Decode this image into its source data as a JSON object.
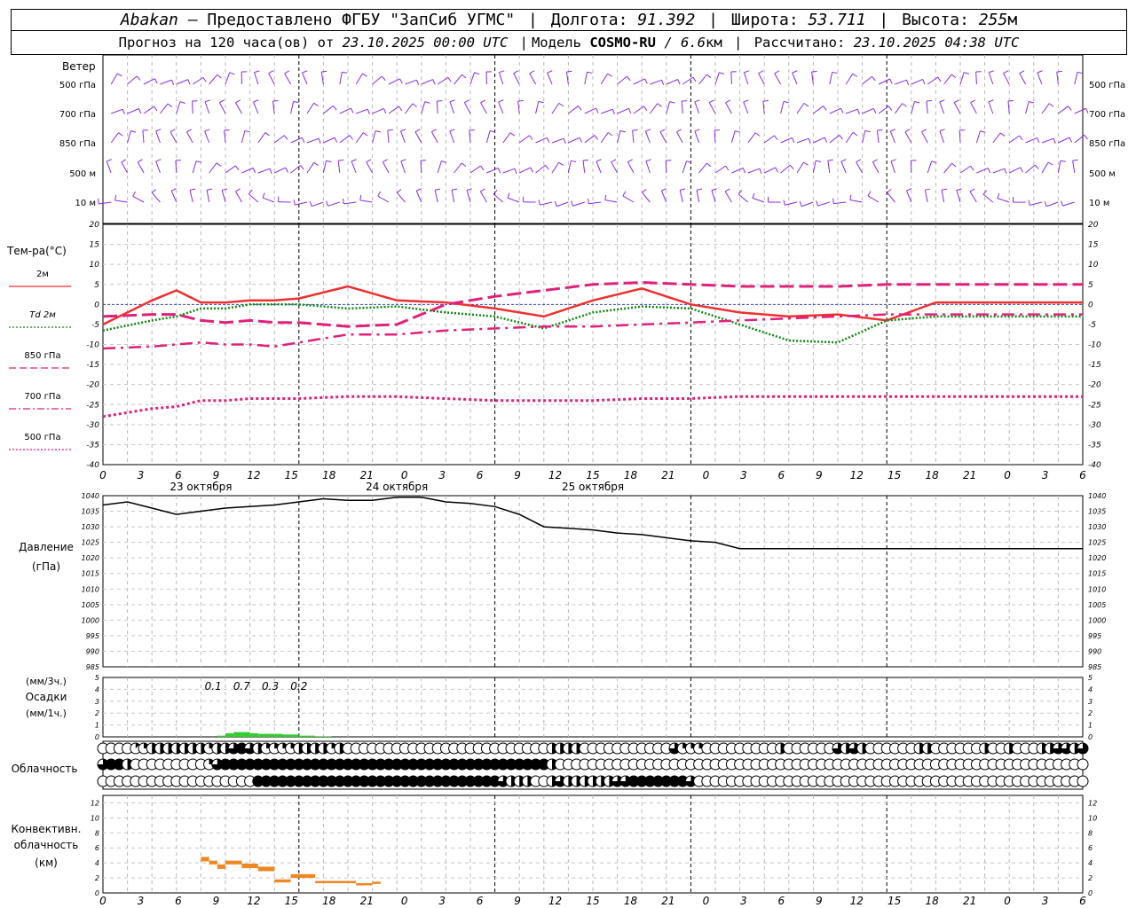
{
  "header": {
    "station": "Abakan",
    "dash": "—",
    "provider": "Предоставлено ФГБУ \"ЗапСиб УГМС\"",
    "lon_label": "Долгота:",
    "lon": "91.392",
    "lat_label": "Широта:",
    "lat": "53.711",
    "alt_label": "Высота:",
    "alt": "255",
    "alt_unit": "м",
    "forecast_label": "Прогноз на 120 часа(ов) от",
    "forecast_start": "23.10.2025 00:00 UTC",
    "model_label": "Модель",
    "model": "COSMO-RU",
    "model_res": "/ 6.6",
    "model_res_unit": "км",
    "computed_label": "Рассчитано:",
    "computed": "23.10.2025 04:38 UTC"
  },
  "wind_panel": {
    "title": "Ветер",
    "levels": [
      "500 гПа",
      "700 гПа",
      "850 гПа",
      "500 м",
      "10 м"
    ]
  },
  "temp_panel": {
    "title": "Тем-ра(°C)",
    "legend": [
      {
        "label": "2м",
        "color": "#ee3030",
        "style": "solid"
      },
      {
        "label": "Td  2м",
        "color": "#118811",
        "style": "dotted"
      },
      {
        "label": "850 гПа",
        "color": "#e0207a",
        "style": "dashed"
      },
      {
        "label": "700 гПа",
        "color": "#e0207a",
        "style": "dashdot"
      },
      {
        "label": "500 гПа",
        "color": "#e0207a",
        "style": "dotted"
      }
    ],
    "yticks": [
      20,
      15,
      10,
      5,
      0,
      -5,
      -10,
      -15,
      -20,
      -25,
      -30,
      -35,
      -40
    ]
  },
  "time_axis": {
    "hours": [
      "0",
      "3",
      "6",
      "9",
      "12",
      "15",
      "18",
      "21",
      "0",
      "3",
      "6",
      "9",
      "12",
      "15",
      "18",
      "21",
      "0",
      "3",
      "6",
      "9",
      "12",
      "15",
      "18",
      "21",
      "0",
      "3",
      "6"
    ],
    "dates": [
      "23 октября",
      "24 октября",
      "25 октября"
    ]
  },
  "pressure_panel": {
    "title": "Давление",
    "unit": "(гПа)",
    "yticks": [
      1040,
      1035,
      1030,
      1025,
      1020,
      1015,
      1010,
      1005,
      1000,
      995,
      990,
      985
    ]
  },
  "precip_panel": {
    "label_1": "(мм/3ч.)",
    "label_2": "Осадки",
    "label_3": "(мм/1ч.)",
    "yticks": [
      5,
      4,
      3,
      2,
      1,
      0
    ],
    "totals": [
      "0.1",
      "0.7",
      "0.3",
      "0.2"
    ]
  },
  "cloud_panel": {
    "title": "Облачность"
  },
  "conv_panel": {
    "title_1": "Конвективн.",
    "title_2": "облачность",
    "title_3": "(км)",
    "yticks": [
      12,
      10,
      8,
      6,
      4,
      2,
      0
    ]
  },
  "chart_data": [
    {
      "type": "line",
      "title": "Тем-ра(°C)",
      "x_unit": "hours from 23.10.2025 00:00 UTC",
      "ylim": [
        -40,
        20
      ],
      "grid": true,
      "x": [
        0,
        6,
        9,
        12,
        15,
        18,
        21,
        24,
        30,
        36,
        42,
        48,
        54,
        60,
        66,
        72,
        78,
        84,
        90,
        96,
        102,
        108,
        114,
        120
      ],
      "series": [
        {
          "name": "2м",
          "values": [
            -5,
            1,
            3.5,
            0.5,
            0.5,
            1,
            1,
            1.5,
            4.5,
            1,
            0.5,
            -1,
            -3,
            1,
            4,
            0,
            -2,
            -3,
            -2.5,
            -4,
            0.5,
            0.5,
            0.5,
            0.5
          ]
        },
        {
          "name": "Td  2м",
          "values": [
            -6.5,
            -4,
            -3,
            -1,
            -1,
            0,
            0,
            0,
            -1,
            -0.5,
            -2,
            -3,
            -6,
            -2,
            -0.5,
            -1,
            -5,
            -9,
            -9.5,
            -4,
            -3,
            -3,
            -3,
            -3
          ]
        },
        {
          "name": "850 гПа",
          "values": [
            -3,
            -2.5,
            -2.5,
            -4,
            -4.5,
            -4,
            -4.5,
            -4.5,
            -5.5,
            -5,
            0,
            2,
            3.5,
            5,
            5.5,
            5,
            4.5,
            4.5,
            4.5,
            5,
            5,
            5,
            5,
            5
          ]
        },
        {
          "name": "700 гПа",
          "values": [
            -11,
            -10.5,
            -10,
            -9.5,
            -10,
            -10,
            -10.5,
            -9.5,
            -7.5,
            -7.5,
            -6.5,
            -6,
            -5.5,
            -5.5,
            -5,
            -4.5,
            -4,
            -3.5,
            -3,
            -2.5,
            -2.5,
            -2.5,
            -2.5,
            -2.5
          ]
        },
        {
          "name": "500 гПа",
          "values": [
            -28,
            -26,
            -25.5,
            -24,
            -24,
            -23.5,
            -23.5,
            -23.5,
            -23,
            -23,
            -23.5,
            -24,
            -24,
            -24,
            -23.5,
            -23.5,
            -23,
            -23,
            -23,
            -23,
            -23,
            -23,
            -23,
            -23
          ]
        }
      ]
    },
    {
      "type": "line",
      "title": "Давление",
      "ylabel": "(гПа)",
      "x_unit": "hours from 23.10.2025 00:00 UTC",
      "ylim": [
        985,
        1040
      ],
      "grid": true,
      "x": [
        0,
        3,
        6,
        9,
        12,
        15,
        18,
        21,
        24,
        27,
        30,
        33,
        36,
        39,
        42,
        45,
        48,
        51,
        54,
        57,
        60,
        63,
        66,
        69,
        72,
        75,
        78,
        81,
        84,
        87,
        90,
        93,
        96,
        99,
        102,
        105,
        108,
        111,
        114,
        117,
        120
      ],
      "series": [
        {
          "name": "Давление",
          "values": [
            1037,
            1038,
            1036,
            1034,
            1035,
            1036,
            1036.5,
            1037,
            1038,
            1039,
            1038.5,
            1038.5,
            1039.5,
            1039.5,
            1038,
            1037.5,
            1036.5,
            1034,
            1030,
            1029.5,
            1029,
            1028,
            1027.5,
            1026.5,
            1025.5,
            1025,
            1023,
            1023,
            1023,
            1023,
            1023,
            1023,
            1023,
            1023,
            1023,
            1023,
            1023,
            1023,
            1023,
            1023,
            1023
          ]
        }
      ]
    },
    {
      "type": "bar",
      "title": "Осадки",
      "ylabel": "(мм/1ч.)",
      "ylim": [
        0,
        5
      ],
      "x": [
        14,
        15,
        16,
        17,
        18,
        19,
        20,
        21,
        22,
        23,
        24,
        25,
        26,
        27
      ],
      "values": [
        0.1,
        0.3,
        0.4,
        0.4,
        0.3,
        0.25,
        0.25,
        0.25,
        0.2,
        0.2,
        0.1,
        0.1,
        0.05,
        0.05
      ]
    },
    {
      "type": "bar",
      "title": "Конвективн. облачность",
      "ylabel": "(км)",
      "ylim": [
        0,
        13
      ],
      "series": [
        {
          "x0": 12,
          "x1": 13,
          "base": 4.2,
          "top": 4.8
        },
        {
          "x0": 13,
          "x1": 14,
          "base": 3.8,
          "top": 4.3
        },
        {
          "x0": 14,
          "x1": 15,
          "base": 3.2,
          "top": 3.8
        },
        {
          "x0": 15,
          "x1": 17,
          "base": 3.8,
          "top": 4.3
        },
        {
          "x0": 17,
          "x1": 19,
          "base": 3.3,
          "top": 3.9
        },
        {
          "x0": 19,
          "x1": 21,
          "base": 2.9,
          "top": 3.5
        },
        {
          "x0": 21,
          "x1": 23,
          "base": 1.4,
          "top": 1.8
        },
        {
          "x0": 23,
          "x1": 26,
          "base": 2.0,
          "top": 2.5
        },
        {
          "x0": 26,
          "x1": 31,
          "base": 1.3,
          "top": 1.6
        },
        {
          "x0": 31,
          "x1": 33,
          "base": 1.0,
          "top": 1.3
        },
        {
          "x0": 33,
          "x1": 34,
          "base": 1.2,
          "top": 1.5
        }
      ]
    }
  ],
  "cloud_cover": {
    "note": "three rows of fractional cloud cover per hour, 0-8 octas",
    "rows": [
      [
        0,
        0,
        0,
        0,
        1,
        2,
        4,
        4,
        4,
        4,
        4,
        4,
        4,
        2,
        4,
        4,
        6,
        8,
        6,
        4,
        2,
        2,
        2,
        2,
        4,
        4,
        4,
        4,
        2,
        4,
        0,
        0,
        0,
        0,
        0,
        0,
        0,
        0,
        0,
        0,
        0,
        0,
        0,
        0,
        0,
        0,
        0,
        0,
        0,
        0,
        0,
        0,
        0,
        0,
        0,
        4,
        4,
        4,
        4,
        0,
        0,
        0,
        0,
        0,
        0,
        0,
        0,
        0,
        0,
        0,
        6,
        2,
        2,
        2,
        0,
        0,
        0,
        0,
        0,
        0,
        0,
        0,
        0,
        4,
        0,
        0,
        0,
        0,
        0,
        0,
        6,
        4,
        6,
        4,
        0,
        0,
        0,
        0,
        0,
        0,
        4,
        4,
        0,
        0,
        0,
        0,
        0,
        0,
        4,
        0,
        0,
        4,
        0,
        0,
        0,
        4,
        4,
        6,
        6,
        4,
        6
      ],
      [
        6,
        8,
        8,
        4,
        0,
        0,
        0,
        0,
        0,
        0,
        0,
        0,
        0,
        2,
        6,
        8,
        8,
        8,
        8,
        8,
        8,
        8,
        8,
        8,
        8,
        8,
        8,
        8,
        8,
        8,
        8,
        8,
        8,
        8,
        8,
        8,
        8,
        8,
        8,
        8,
        8,
        8,
        8,
        8,
        8,
        8,
        8,
        8,
        8,
        8,
        8,
        8,
        8,
        8,
        8,
        4,
        0,
        0,
        0,
        0,
        0,
        0,
        0,
        0,
        0,
        0,
        0,
        0,
        0,
        0,
        0,
        0,
        0,
        0,
        0,
        0,
        0,
        0,
        0,
        0,
        0,
        0,
        0,
        0,
        0,
        0,
        0,
        0,
        0,
        0,
        0,
        0,
        0,
        0,
        0,
        0,
        0,
        0,
        0,
        0,
        0,
        0,
        0,
        0,
        0,
        0,
        0,
        0,
        0,
        0,
        0,
        0,
        0,
        0,
        0,
        0,
        0,
        0,
        0,
        0,
        0
      ],
      [
        0,
        0,
        0,
        0,
        0,
        0,
        0,
        0,
        0,
        0,
        0,
        0,
        0,
        0,
        0,
        0,
        0,
        0,
        0,
        8,
        8,
        8,
        8,
        8,
        8,
        8,
        8,
        8,
        8,
        8,
        8,
        8,
        8,
        8,
        8,
        8,
        8,
        8,
        8,
        8,
        8,
        8,
        8,
        8,
        8,
        8,
        8,
        8,
        8,
        6,
        4,
        4,
        4,
        0,
        0,
        4,
        6,
        4,
        4,
        4,
        4,
        4,
        4,
        6,
        6,
        8,
        8,
        8,
        8,
        8,
        8,
        8,
        6,
        0,
        0,
        0,
        0,
        0,
        0,
        0,
        0,
        0,
        0,
        0,
        0,
        0,
        0,
        0,
        0,
        0,
        0,
        0,
        0,
        0,
        0,
        0,
        0,
        0,
        0,
        0,
        0,
        0,
        0,
        0,
        0,
        0,
        0,
        0,
        0,
        0,
        0,
        0,
        0,
        0,
        0,
        0,
        0,
        0,
        0,
        0,
        0
      ]
    ]
  },
  "colors": {
    "wind": "#8a2be2",
    "t2m": "#ee3030",
    "td2m": "#118811",
    "upper": "#e0207a",
    "precip": "#33cc33",
    "conv": "#ee8822",
    "zero_line": "#3344cc"
  }
}
